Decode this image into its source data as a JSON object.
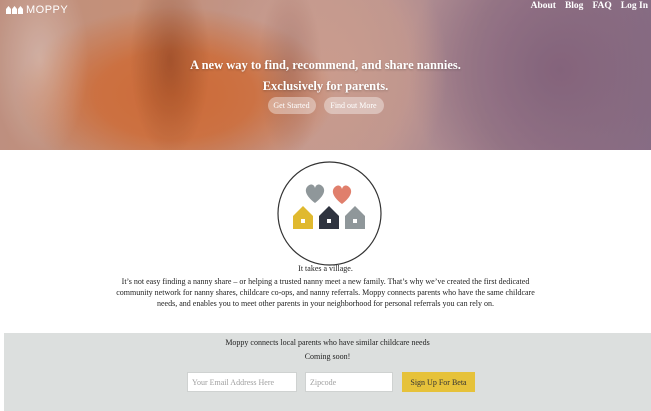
{
  "header": {
    "logo_text": "MOPPY",
    "nav": [
      "About",
      "Blog",
      "FAQ",
      "Log In"
    ]
  },
  "hero": {
    "line1": "A new way to find, recommend, and share nannies.",
    "line2": "Exclusively for parents.",
    "get_started_label": "Get Started",
    "find_out_more_label": "Find out More"
  },
  "emblem": {
    "heart_colors": [
      "#8f979a",
      "#e07f6c"
    ],
    "house_colors": [
      "#e0b92f",
      "#2f3440",
      "#8f979a"
    ]
  },
  "intro": {
    "heading": "It takes a village.",
    "body": "It’s not easy finding a nanny share – or helping a trusted nanny meet a new family. That’s why we’ve created the first dedicated community network for nanny shares, childcare co-ops, and nanny referrals. Moppy connects parents who have the same childcare needs, and enables you to meet other parents in your neighborhood for personal referrals you can rely on."
  },
  "signup": {
    "message": "Moppy connects local parents who have similar childcare needs",
    "coming_soon": "Coming soon!",
    "email_placeholder": "Your Email Address Here",
    "zip_placeholder": "Zipcode",
    "button_label": "Sign Up For Beta",
    "button_color": "#e6c23a",
    "background_color": "#dcdfde"
  }
}
